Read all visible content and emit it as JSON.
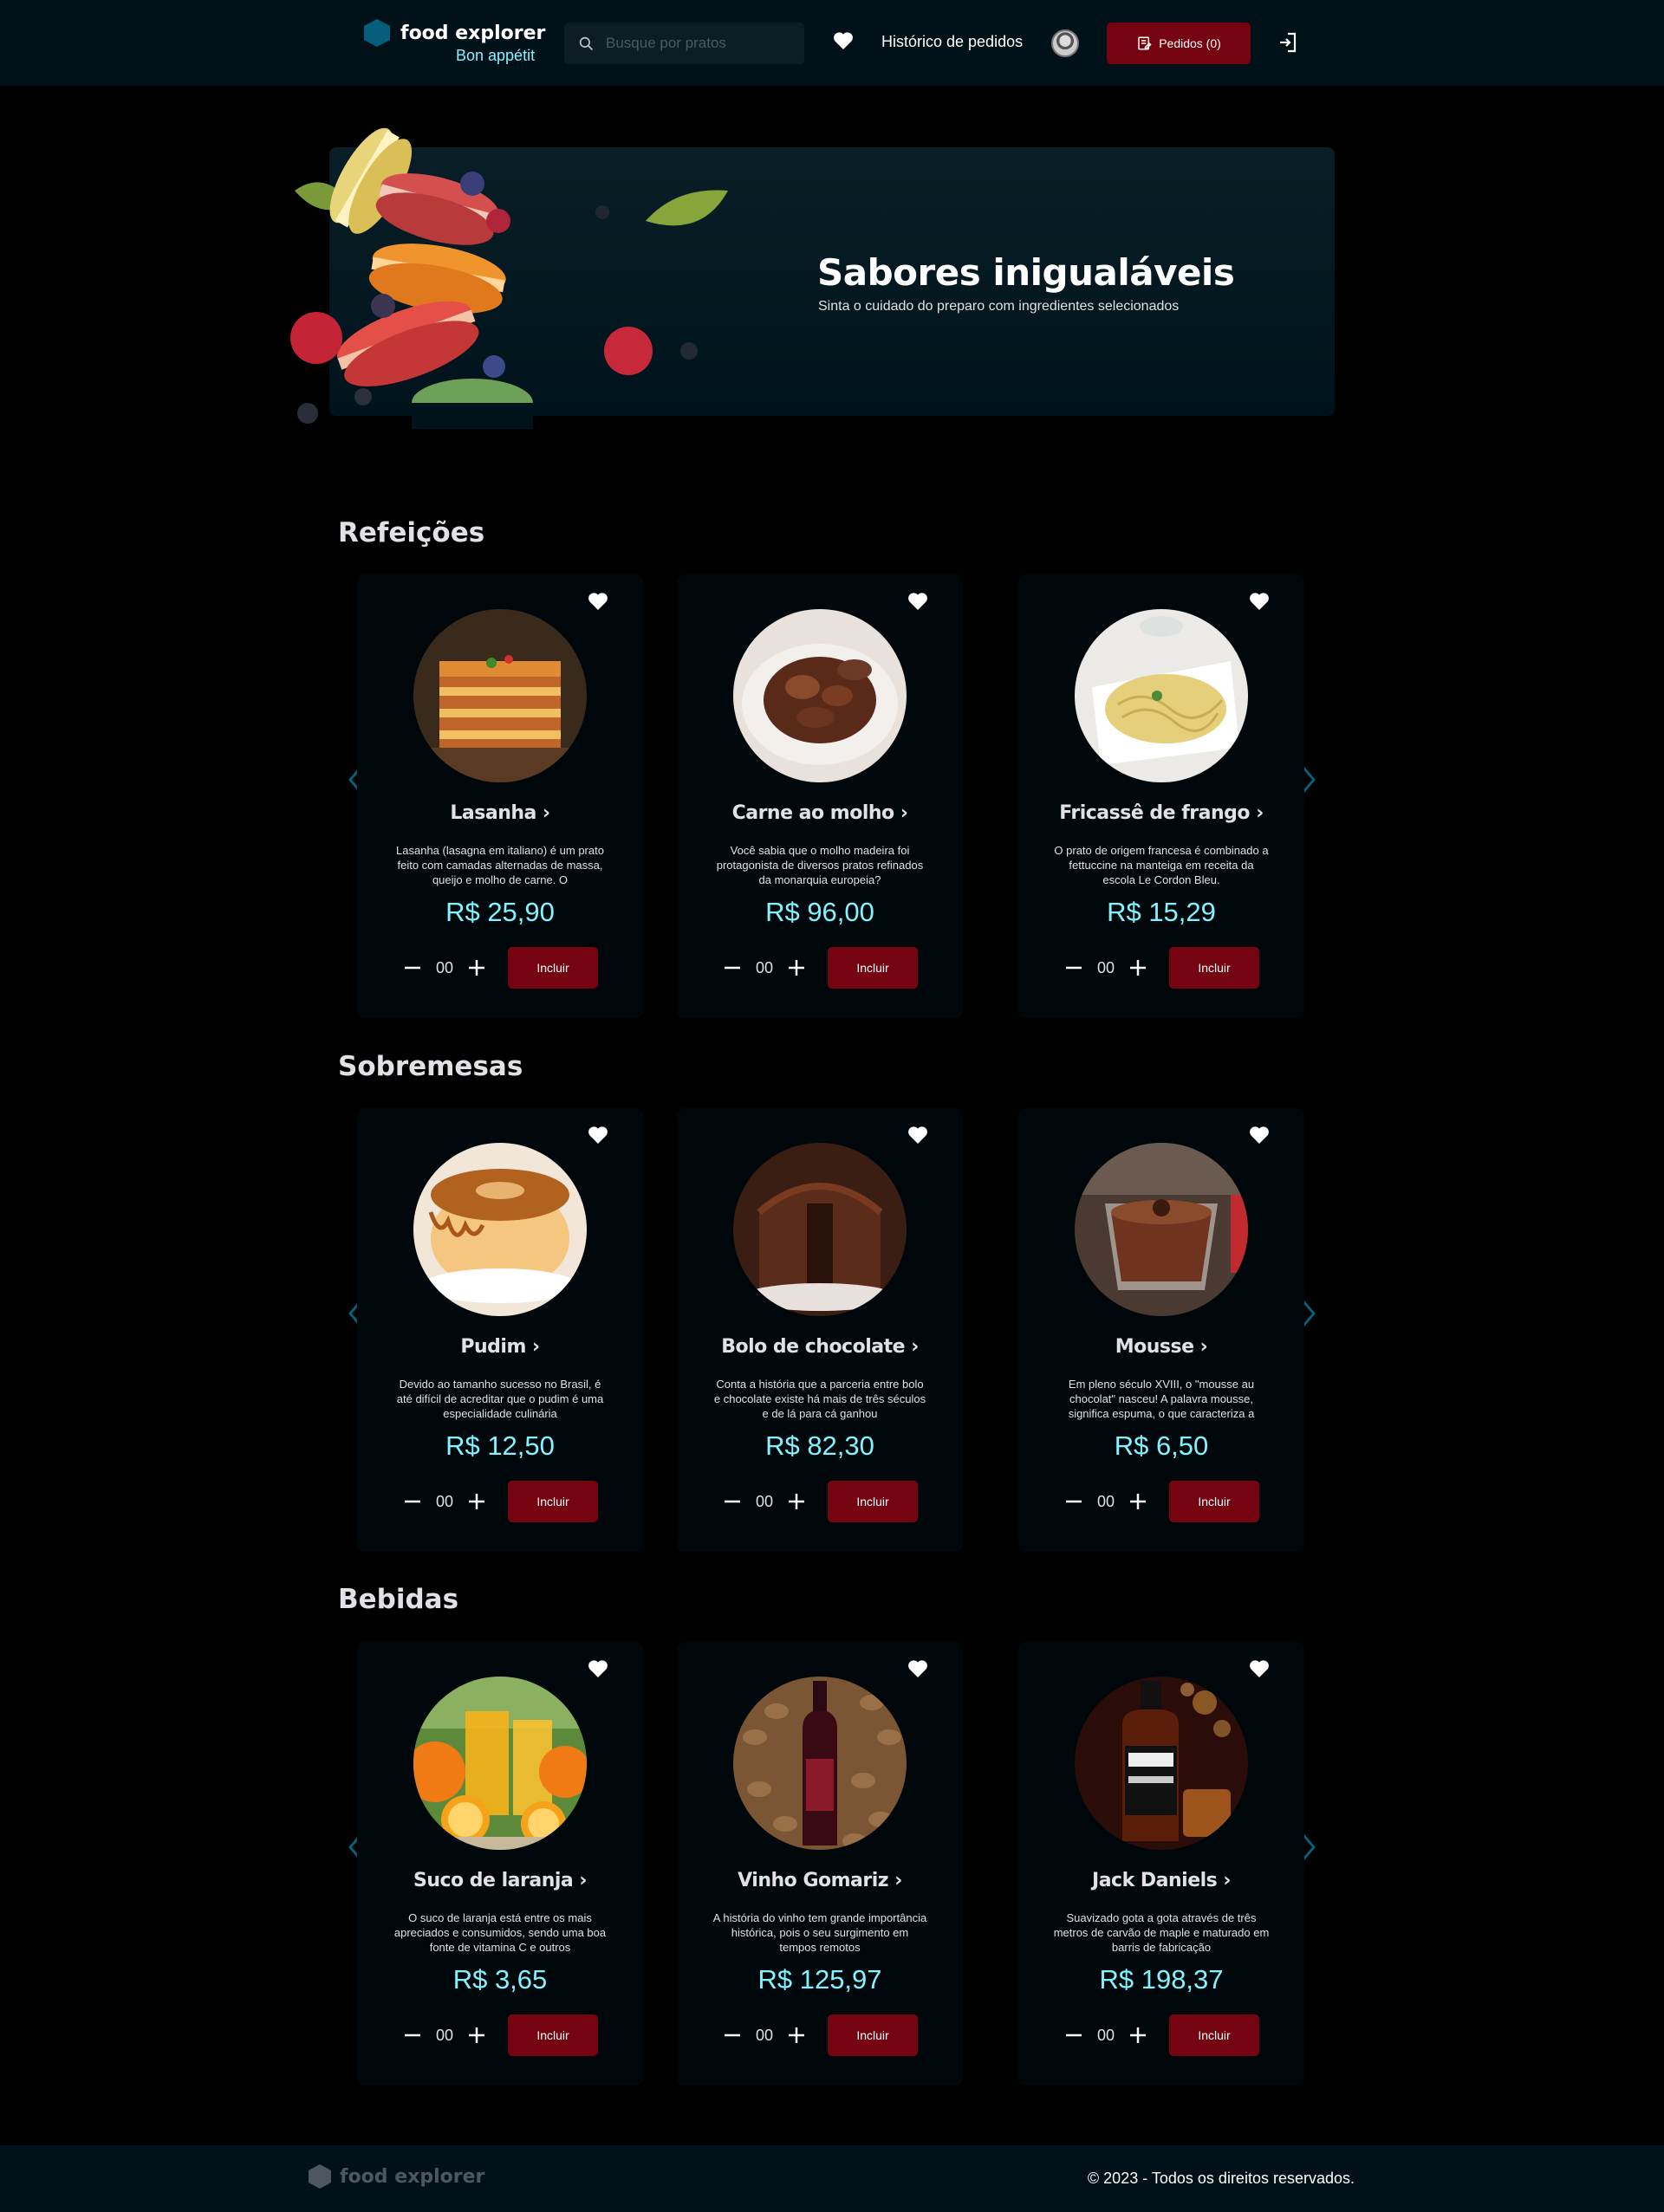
{
  "header": {
    "brand": "food explorer",
    "tagline": "Bon appétit",
    "search_placeholder": "Busque por pratos",
    "history_label": "Histórico de pedidos",
    "orders_label": "Pedidos (0)"
  },
  "banner": {
    "title": "Sabores inigualáveis",
    "subtitle": "Sinta o cuidado do preparo com ingredientes selecionados"
  },
  "sections": [
    {
      "title": "Refeições",
      "dishes": [
        {
          "name": "Lasanha",
          "desc": "Lasanha (lasagna em italiano) é um prato feito com camadas alternadas de massa, queijo e molho de carne. O",
          "price": "R$ 25,90",
          "qty": "00",
          "button": "Incluir",
          "image": "lasagna-photo"
        },
        {
          "name": "Carne ao molho",
          "desc": "Você sabia que o molho madeira foi protagonista de diversos pratos refinados da monarquia europeia?",
          "price": "R$ 96,00",
          "qty": "00",
          "button": "Incluir",
          "image": "meat-sauce-photo"
        },
        {
          "name": "Fricassê de frango",
          "desc": "O prato de origem francesa é combinado a fettuccine na manteiga em receita da escola Le Cordon Bleu.",
          "price": "R$ 15,29",
          "qty": "00",
          "button": "Incluir",
          "image": "pasta-photo"
        }
      ]
    },
    {
      "title": "Sobremesas",
      "dishes": [
        {
          "name": "Pudim",
          "desc": "Devido ao tamanho sucesso no Brasil, é até difícil de acreditar que o pudim é uma especialidade culinária",
          "price": "R$ 12,50",
          "qty": "00",
          "button": "Incluir",
          "image": "pudding-photo"
        },
        {
          "name": "Bolo de chocolate",
          "desc": "Conta a história que a parceria entre bolo e chocolate existe há mais de três séculos e de lá para cá ganhou",
          "price": "R$ 82,30",
          "qty": "00",
          "button": "Incluir",
          "image": "chocolate-cake-photo"
        },
        {
          "name": "Mousse",
          "desc": "Em pleno século XVIII, o \"mousse au chocolat\" nasceu! A palavra mousse, significa espuma, o que caracteriza a",
          "price": "R$ 6,50",
          "qty": "00",
          "button": "Incluir",
          "image": "mousse-photo"
        }
      ]
    },
    {
      "title": "Bebidas",
      "dishes": [
        {
          "name": "Suco de laranja",
          "desc": "O suco de laranja está entre os mais apreciados e consumidos, sendo uma boa fonte de vitamina C e outros",
          "price": "R$ 3,65",
          "qty": "00",
          "button": "Incluir",
          "image": "orange-juice-photo"
        },
        {
          "name": "Vinho Gomariz",
          "desc": "A história do vinho tem grande importância histórica, pois o seu surgimento em tempos remotos",
          "price": "R$ 125,97",
          "qty": "00",
          "button": "Incluir",
          "image": "wine-bottle-photo"
        },
        {
          "name": "Jack Daniels",
          "desc": "Suavizado gota a gota através de três metros de carvão de maple e maturado em barris de fabricação",
          "price": "R$ 198,37",
          "qty": "00",
          "button": "Incluir",
          "image": "whiskey-bottle-photo"
        }
      ]
    }
  ],
  "footer": {
    "brand": "food explorer",
    "copyright": "© 2023 - Todos os direitos reservados."
  }
}
